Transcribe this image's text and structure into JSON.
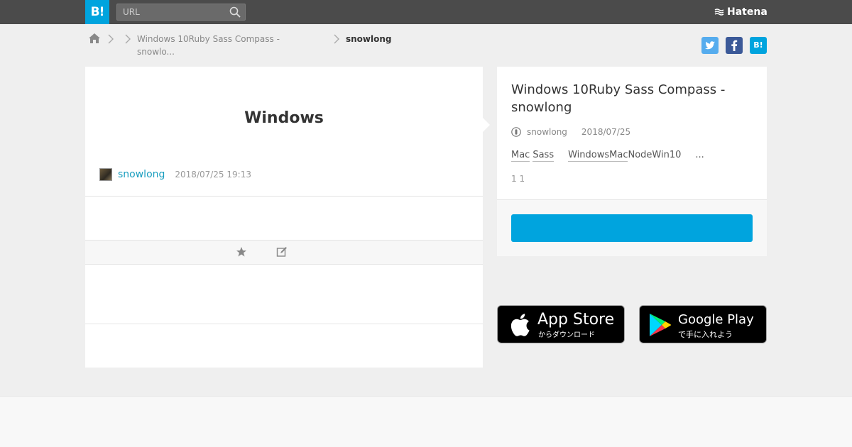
{
  "header": {
    "logo_text": "B!",
    "search_placeholder": "URL",
    "brand": "Hatena"
  },
  "breadcrumb": {
    "entry_line1": "Windows 10Ruby Sass Compass  -",
    "entry_line2": "snowlo...",
    "current": "snowlong"
  },
  "share": {
    "hatena_label": "B!"
  },
  "entry": {
    "title": "Windows",
    "author": "snowlong",
    "datetime": "2018/07/25 19:13"
  },
  "side": {
    "title": "Windows 10Ruby Sass Compass  - snowlong",
    "user": "snowlong",
    "date": "2018/07/25",
    "tags": [
      "Mac",
      "Sass",
      "WindowsMac",
      "NodeWin10",
      "..."
    ],
    "count": "1 1"
  },
  "stores": {
    "apple_main": "App Store",
    "apple_sub": "からダウンロード",
    "google_main": "Google Play",
    "google_sub": "で手に入れよう"
  },
  "colors": {
    "brand_blue": "#00a4de",
    "header_bg": "#4b4b4b",
    "link_teal": "#1a9ebf"
  }
}
